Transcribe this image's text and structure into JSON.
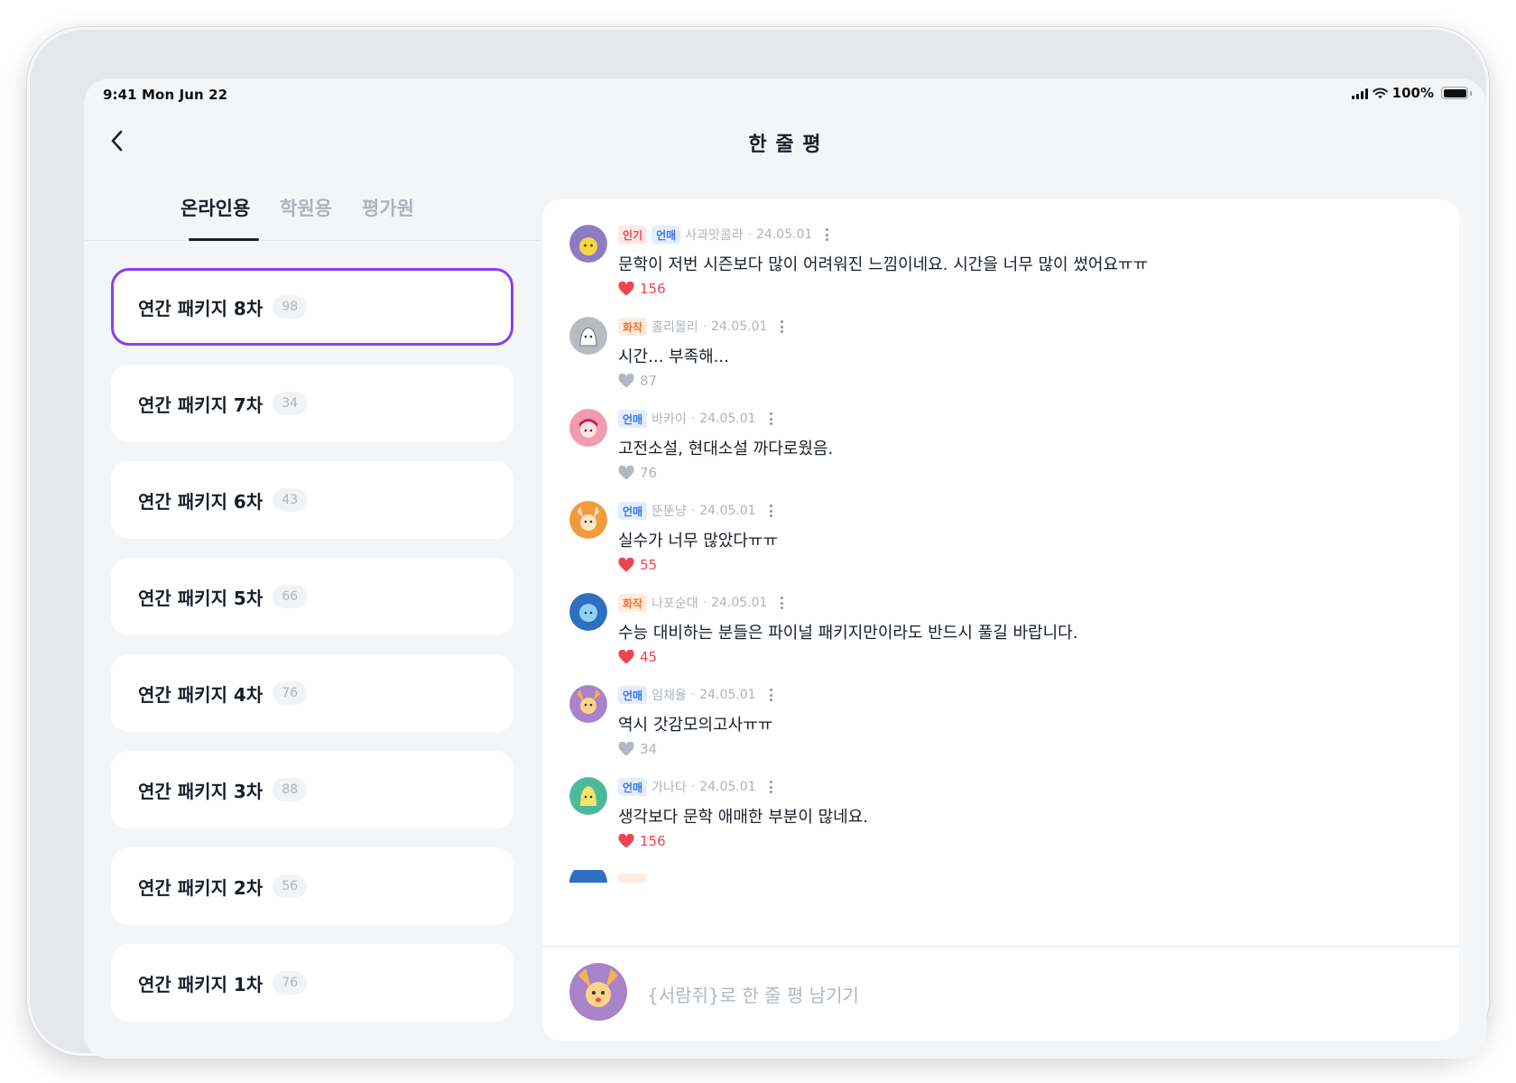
{
  "status_bar": {
    "time": "9:41  Mon Jun 22",
    "battery": "100%"
  },
  "header": {
    "title": "한 줄 평"
  },
  "tabs": [
    {
      "label": "온라인용",
      "active": true
    },
    {
      "label": "학원용",
      "active": false
    },
    {
      "label": "평가원",
      "active": false
    }
  ],
  "packages": [
    {
      "label": "연간 패키지 8차",
      "count": "98",
      "selected": true
    },
    {
      "label": "연간 패키지 7차",
      "count": "34",
      "selected": false
    },
    {
      "label": "연간 패키지 6차",
      "count": "43",
      "selected": false
    },
    {
      "label": "연간 패키지 5차",
      "count": "66",
      "selected": false
    },
    {
      "label": "연간 패키지 4차",
      "count": "76",
      "selected": false
    },
    {
      "label": "연간 패키지 3차",
      "count": "88",
      "selected": false
    },
    {
      "label": "연간 패키지 2차",
      "count": "56",
      "selected": false
    },
    {
      "label": "연간 패키지 1차",
      "count": "76",
      "selected": false
    }
  ],
  "comments": [
    {
      "badges": [
        "인기",
        "언매"
      ],
      "author": "사과맛콜라",
      "date": "24.05.01",
      "text": "문학이 저번 시즌보다 많이 어려워진 느낌이네요. 시간을 너무 많이 썼어요ㅠㅠ",
      "likes": "156",
      "liked": true,
      "avatar_color": "#8e7cc3"
    },
    {
      "badges": [
        "화작"
      ],
      "author": "홀리몰리",
      "date": "24.05.01",
      "text": "시간... 부족해...",
      "likes": "87",
      "liked": false,
      "avatar_color": "#b8bcc2"
    },
    {
      "badges": [
        "언매"
      ],
      "author": "바카이",
      "date": "24.05.01",
      "text": "고전소설, 현대소설 까다로웠음.",
      "likes": "76",
      "liked": false,
      "avatar_color": "#f29bae"
    },
    {
      "badges": [
        "언매"
      ],
      "author": "뚠뚠냥",
      "date": "24.05.01",
      "text": "실수가 너무 많았다ㅠㅠ",
      "likes": "55",
      "liked": true,
      "avatar_color": "#f29b3c"
    },
    {
      "badges": [
        "화작"
      ],
      "author": "나포순대",
      "date": "24.05.01",
      "text": "수능 대비하는 분들은 파이널 패키지만이라도 반드시 풀길 바랍니다.",
      "likes": "45",
      "liked": true,
      "avatar_color": "#2f6fc0"
    },
    {
      "badges": [
        "언매"
      ],
      "author": "임채율",
      "date": "24.05.01",
      "text": "역시 갓감모의고사ㅠㅠ",
      "likes": "34",
      "liked": false,
      "avatar_color": "#a883c9"
    },
    {
      "badges": [
        "언매"
      ],
      "author": "가나다",
      "date": "24.05.01",
      "text": "생각보다 문학 애매한 부분이 많네요.",
      "likes": "156",
      "liked": true,
      "avatar_color": "#4cb99a"
    }
  ],
  "input": {
    "placeholder": "{서람쥐}로 한 줄 평 남기기"
  },
  "colors": {
    "accent": "#8a3ff0",
    "like": "#f04452",
    "badge_eonmae": "#3b73e9",
    "badge_hwajak": "#f27227"
  },
  "icons": {
    "back": "chevron-left-icon",
    "like": "heart-icon",
    "more": "more-vertical-icon"
  }
}
